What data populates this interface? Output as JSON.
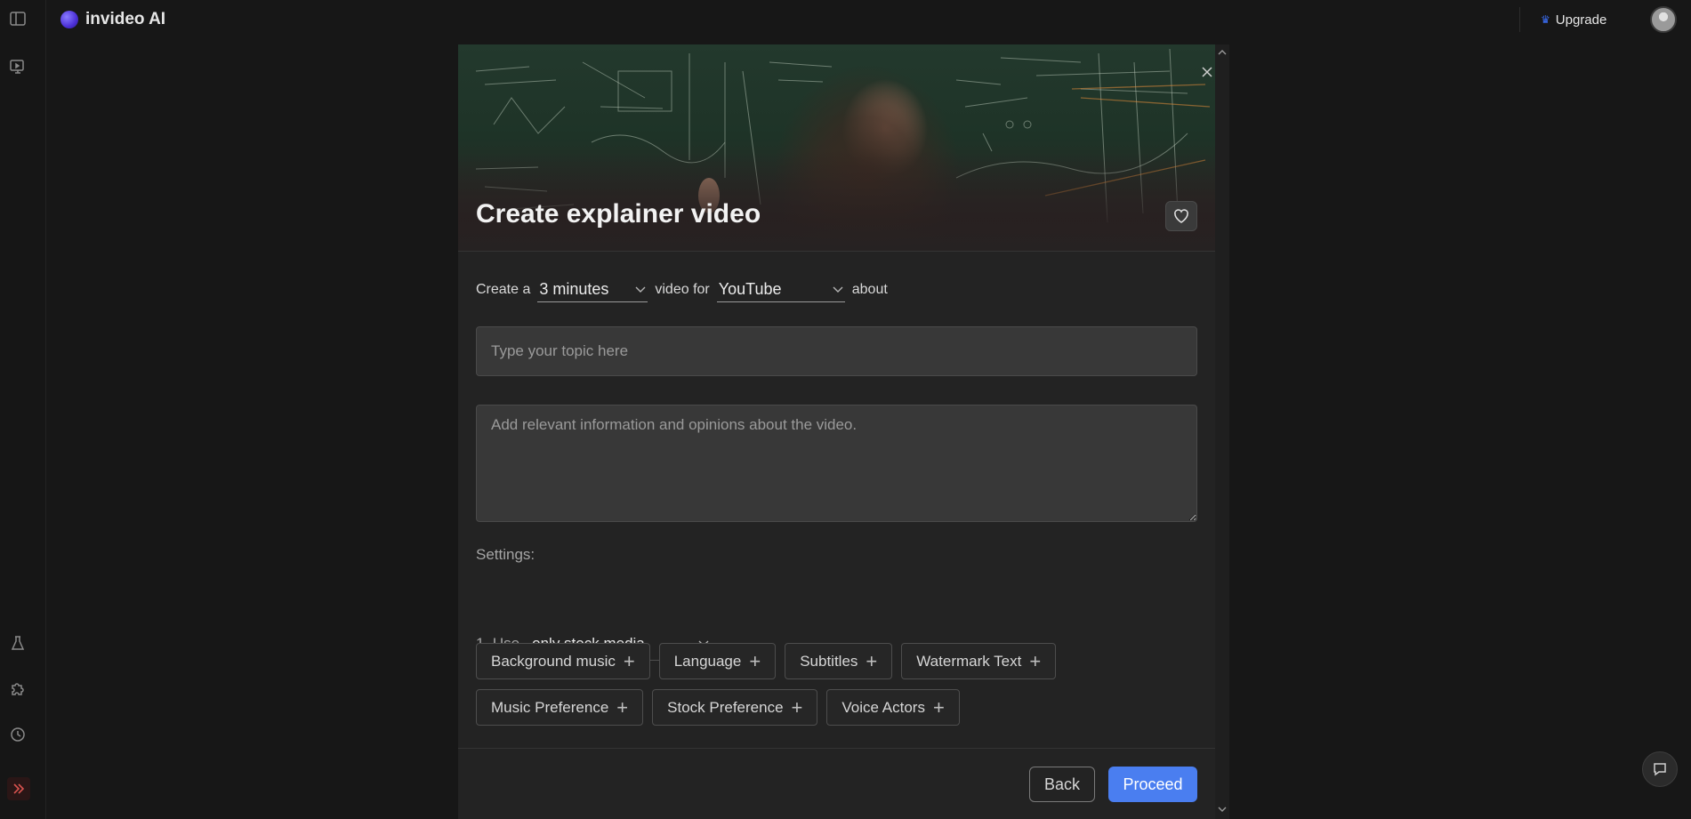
{
  "app": {
    "name": "invideo AI"
  },
  "header": {
    "upgrade_label": "Upgrade"
  },
  "modal": {
    "title": "Create explainer video",
    "sentence": {
      "prefix": "Create a",
      "duration": "3 minutes",
      "middle": "video for",
      "platform": "YouTube",
      "suffix": "about"
    },
    "topic_placeholder": "Type your topic here",
    "details_placeholder": "Add relevant information and opinions about the video.",
    "settings_label": "Settings:",
    "use_label": "1. Use",
    "use_value": "only stock media",
    "chips_row1": [
      "Background music",
      "Language",
      "Subtitles",
      "Watermark Text"
    ],
    "chips_row2": [
      "Music Preference",
      "Stock Preference",
      "Voice Actors"
    ],
    "back_label": "Back",
    "proceed_label": "Proceed"
  },
  "colors": {
    "background": "#171717",
    "modal": "#232323",
    "accent": "#4a7ef0",
    "collapse": "#d9534f"
  },
  "icons": [
    "sidebar-toggle-icon",
    "projects-icon",
    "flask-icon",
    "puzzle-icon",
    "history-icon",
    "double-chevron-right-icon",
    "crown-icon",
    "close-icon",
    "heart-icon",
    "chevron-down-icon",
    "plus-icon",
    "chat-icon"
  ]
}
